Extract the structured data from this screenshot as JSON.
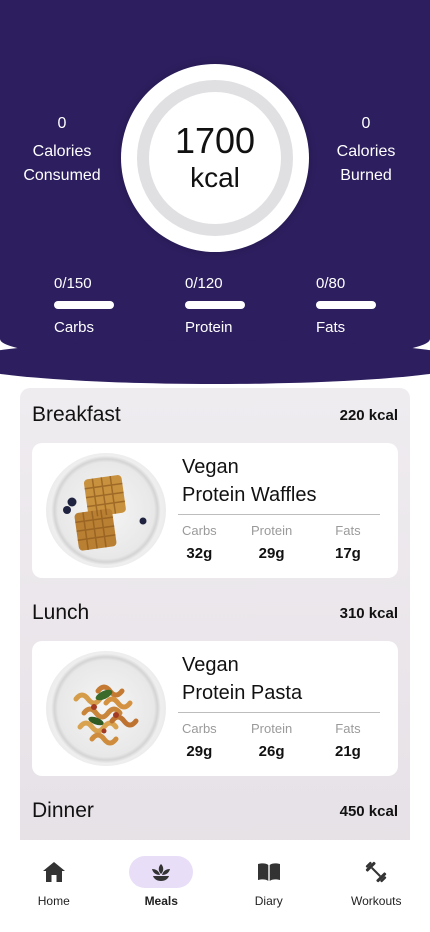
{
  "summary": {
    "consumed": {
      "value": "0",
      "label_line1": "Calories",
      "label_line2": "Consumed"
    },
    "burned": {
      "value": "0",
      "label_line1": "Calories",
      "label_line2": "Burned"
    },
    "goal": {
      "value": "1700",
      "unit": "kcal"
    }
  },
  "macros": [
    {
      "label": "Carbs",
      "progress": "0/150",
      "fill": 0
    },
    {
      "label": "Protein",
      "progress": "0/120",
      "fill": 0
    },
    {
      "label": "Fats",
      "progress": "0/80",
      "fill": 0
    }
  ],
  "meals": [
    {
      "name": "Breakfast",
      "kcal": "220 kcal",
      "food": {
        "title_line1": "Vegan",
        "title_line2": "Protein Waffles"
      },
      "macros": [
        {
          "label": "Carbs",
          "value": "32g"
        },
        {
          "label": "Protein",
          "value": "29g"
        },
        {
          "label": "Fats",
          "value": "17g"
        }
      ]
    },
    {
      "name": "Lunch",
      "kcal": "310 kcal",
      "food": {
        "title_line1": "Vegan",
        "title_line2": "Protein Pasta"
      },
      "macros": [
        {
          "label": "Carbs",
          "value": "29g"
        },
        {
          "label": "Protein",
          "value": "26g"
        },
        {
          "label": "Fats",
          "value": "21g"
        }
      ]
    },
    {
      "name": "Dinner",
      "kcal": "450 kcal"
    }
  ],
  "nav": {
    "items": [
      {
        "label": "Home",
        "icon": "home-icon"
      },
      {
        "label": "Meals",
        "icon": "meals-icon",
        "active": true
      },
      {
        "label": "Diary",
        "icon": "book-icon"
      },
      {
        "label": "Workouts",
        "icon": "dumbbell-icon"
      }
    ]
  },
  "colors": {
    "header_bg": "#2d1e5f",
    "active_nav_pill": "#e8def8",
    "panel_bg": "#ebe6eb"
  }
}
